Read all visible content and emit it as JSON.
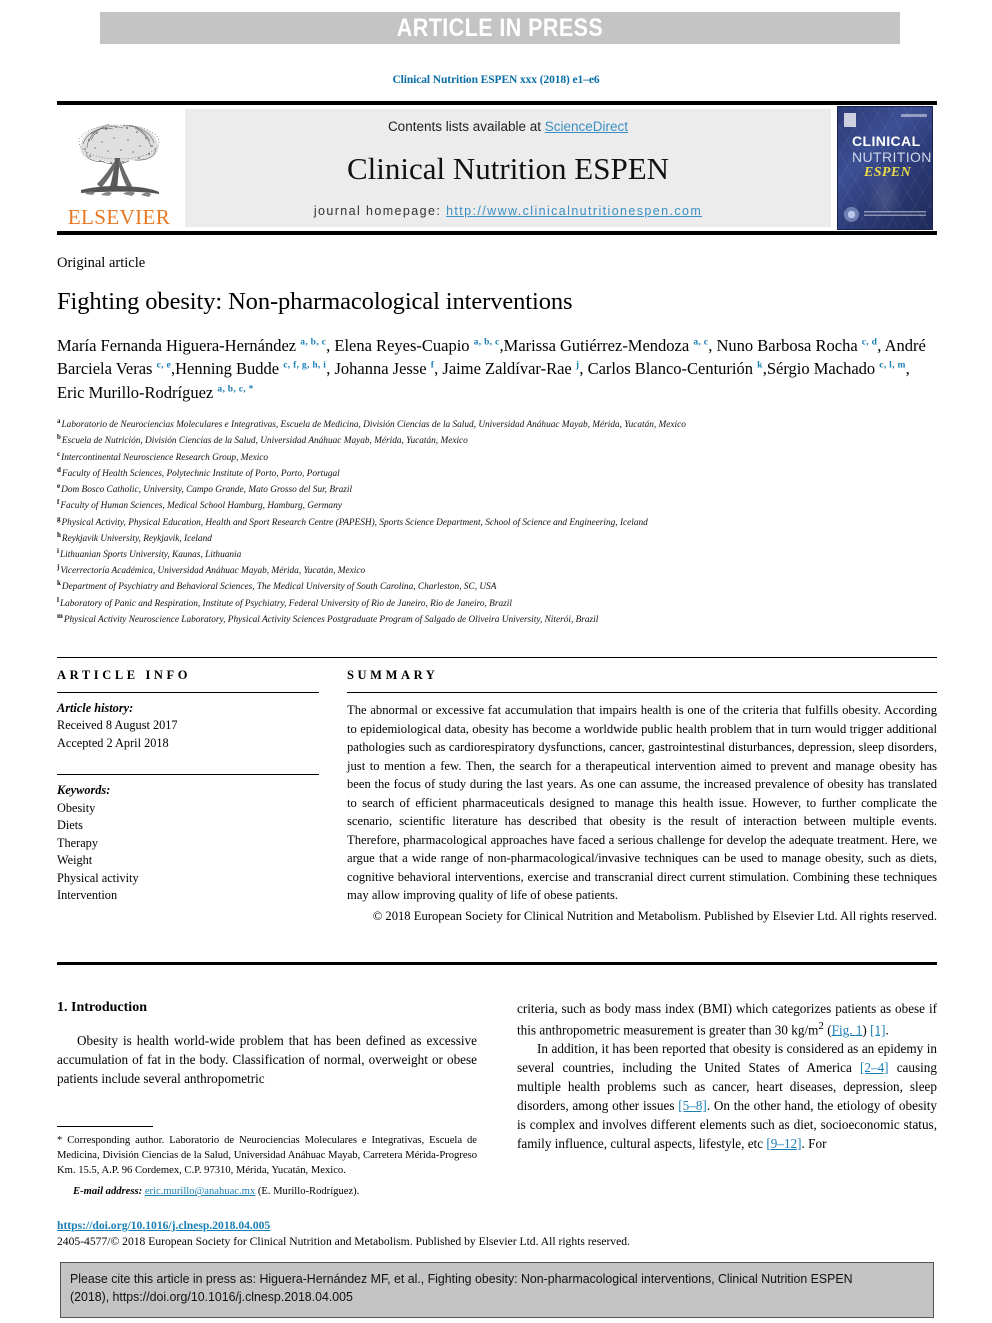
{
  "banner": {
    "text": "ARTICLE IN PRESS"
  },
  "running_head": "Clinical Nutrition ESPEN xxx (2018) e1–e6",
  "masthead": {
    "contents_prefix": "Contents lists available at ",
    "contents_link": "ScienceDirect",
    "journal_title": "Clinical Nutrition ESPEN",
    "homepage_label": "journal homepage: ",
    "homepage_url": "http://www.clinicalnutritionespen.com",
    "publisher": "ELSEVIER",
    "cover": {
      "line1": "CLINICAL",
      "line2": "NUTRITION",
      "line3": "ESPEN"
    }
  },
  "article": {
    "type_label": "Original article",
    "title": "Fighting obesity: Non-pharmacological interventions",
    "authors": [
      {
        "name": "María Fernanda Higuera-Hernández",
        "marks": "a, b, c",
        "sep": ", "
      },
      {
        "name": "Elena Reyes-Cuapio",
        "marks": "a, b, c",
        "sep": ","
      },
      {
        "name": "Marissa Gutiérrez-Mendoza",
        "marks": "a, c",
        "sep": ", "
      },
      {
        "name": "Nuno Barbosa Rocha",
        "marks": "c, d",
        "sep": ", "
      },
      {
        "name": "André Barciela Veras",
        "marks": "c, e",
        "sep": ","
      },
      {
        "name": "Henning Budde",
        "marks": "c, f, g, h, i",
        "sep": ", "
      },
      {
        "name": "Johanna Jesse",
        "marks": "f",
        "sep": ", "
      },
      {
        "name": "Jaime Zaldívar-Rae",
        "marks": "j",
        "sep": ", "
      },
      {
        "name": "Carlos Blanco-Centurión",
        "marks": "k",
        "sep": ","
      },
      {
        "name": "Sérgio Machado",
        "marks": "c, l, m",
        "sep": ", "
      },
      {
        "name": "Eric Murillo-Rodríguez",
        "marks": "a, b, c, *",
        "sep": ""
      }
    ],
    "affiliations": [
      {
        "mark": "a",
        "text": "Laboratorio de Neurociencias Moleculares e Integrativas, Escuela de Medicina, División Ciencias de la Salud, Universidad Anáhuac Mayab, Mérida, Yucatán, Mexico"
      },
      {
        "mark": "b",
        "text": "Escuela de Nutrición, División Ciencias de la Salud, Universidad Anáhuac Mayab, Mérida, Yucatán, Mexico"
      },
      {
        "mark": "c",
        "text": "Intercontinental Neuroscience Research Group, Mexico"
      },
      {
        "mark": "d",
        "text": "Faculty of Health Sciences, Polytechnic Institute of Porto, Porto, Portugal"
      },
      {
        "mark": "e",
        "text": "Dom Bosco Catholic, University, Campo Grande, Mato Grosso del Sur, Brazil"
      },
      {
        "mark": "f",
        "text": "Faculty of Human Sciences, Medical School Hamburg, Hamburg, Germany"
      },
      {
        "mark": "g",
        "text": "Physical Activity, Physical Education, Health and Sport Research Centre (PAPESH), Sports Science Department, School of Science and Engineering, Iceland"
      },
      {
        "mark": "h",
        "text": "Reykjavik University, Reykjavik, Iceland"
      },
      {
        "mark": "i",
        "text": "Lithuanian Sports University, Kaunas, Lithuania"
      },
      {
        "mark": "j",
        "text": "Vicerrectoría Académica, Universidad Anáhuac Mayab, Mérida, Yucatán, Mexico"
      },
      {
        "mark": "k",
        "text": "Department of Psychiatry and Behavioral Sciences, The Medical University of South Carolina, Charleston, SC, USA"
      },
      {
        "mark": "l",
        "text": "Laboratory of Panic and Respiration, Institute of Psychiatry, Federal University of Rio de Janeiro, Rio de Janeiro, Brazil"
      },
      {
        "mark": "m",
        "text": "Physical Activity Neuroscience Laboratory, Physical Activity Sciences Postgraduate Program of Salgado de Oliveira University, Niterói, Brazil"
      }
    ]
  },
  "article_info": {
    "heading": "ARTICLE INFO",
    "history_label": "Article history:",
    "received": "Received 8 August 2017",
    "accepted": "Accepted 2 April 2018",
    "keywords_label": "Keywords:",
    "keywords": [
      "Obesity",
      "Diets",
      "Therapy",
      "Weight",
      "Physical activity",
      "Intervention"
    ]
  },
  "summary": {
    "heading": "SUMMARY",
    "text": "The abnormal or excessive fat accumulation that impairs health is one of the criteria that fulfills obesity. According to epidemiological data, obesity has become a worldwide public health problem that in turn would trigger additional pathologies such as cardiorespiratory dysfunctions, cancer, gastrointestinal disturbances, depression, sleep disorders, just to mention a few. Then, the search for a therapeutical intervention aimed to prevent and manage obesity has been the focus of study during the last years. As one can assume, the increased prevalence of obesity has translated to search of efficient pharmaceuticals designed to manage this health issue. However, to further complicate the scenario, scientific literature has described that obesity is the result of interaction between multiple events. Therefore, pharmacological approaches have faced a serious challenge for develop the adequate treatment. Here, we argue that a wide range of non-pharmacological/invasive techniques can be used to manage obesity, such as diets, cognitive behavioral interventions, exercise and transcranial direct current stimulation. Combining these techniques may allow improving quality of life of obese patients.",
    "copyright": "© 2018 European Society for Clinical Nutrition and Metabolism. Published by Elsevier Ltd. All rights reserved."
  },
  "body": {
    "section_title": "1. Introduction",
    "left_paragraph": "Obesity is health world-wide problem that has been defined as excessive accumulation of fat in the body. Classification of normal, overweight or obese patients include several anthropometric",
    "right_paragraph_1_a": "criteria, such as body mass index (BMI) which categorizes patients as obese if this anthropometric measurement is greater than 30 kg/m",
    "right_paragraph_1_sup": "2",
    "right_paragraph_1_b": " (",
    "right_fig_link": "Fig. 1",
    "right_paragraph_1_c": ") ",
    "right_ref_1": "[1]",
    "right_paragraph_1_d": ".",
    "right_paragraph_2_a": "In addition, it has been reported that obesity is considered as an epidemy in several countries, including the United States of America ",
    "right_ref_2": "[2–4]",
    "right_paragraph_2_b": " causing multiple health problems such as cancer, heart diseases, depression, sleep disorders, among other issues ",
    "right_ref_3": "[5–8]",
    "right_paragraph_2_c": ". On the other hand, the etiology of obesity is complex and involves different elements such as diet, socioeconomic status, family influence, cultural aspects, lifestyle, etc ",
    "right_ref_4": "[9–12]",
    "right_paragraph_2_d": ". For"
  },
  "footnote": {
    "star": "*",
    "text": "Corresponding author. Laboratorio de Neurociencias Moleculares e Integrativas, Escuela de Medicina, División Ciencias de la Salud, Universidad Anáhuac Mayab, Carretera Mérida-Progreso Km. 15.5, A.P. 96 Cordemex, C.P. 97310, Mérida, Yucatán, Mexico.",
    "email_label": "E-mail address:",
    "email": "eric.murillo@anahuac.mx",
    "email_owner": "(E. Murillo-Rodríguez)."
  },
  "doi_block": {
    "doi": "https://doi.org/10.1016/j.clnesp.2018.04.005",
    "issn_line": "2405-4577/© 2018 European Society for Clinical Nutrition and Metabolism. Published by Elsevier Ltd. All rights reserved."
  },
  "cite_box": {
    "line1": "Please cite this article in press as: Higuera-Hernández MF, et al., Fighting obesity: Non-pharmacological interventions, Clinical Nutrition ESPEN",
    "line2": "(2018), https://doi.org/10.1016/j.clnesp.2018.04.005"
  },
  "colors": {
    "link": "#1a7fb5",
    "banner_bg": "#c4c4c4",
    "elsevier_orange": "#e87722",
    "masthead_bg": "#ececec"
  }
}
